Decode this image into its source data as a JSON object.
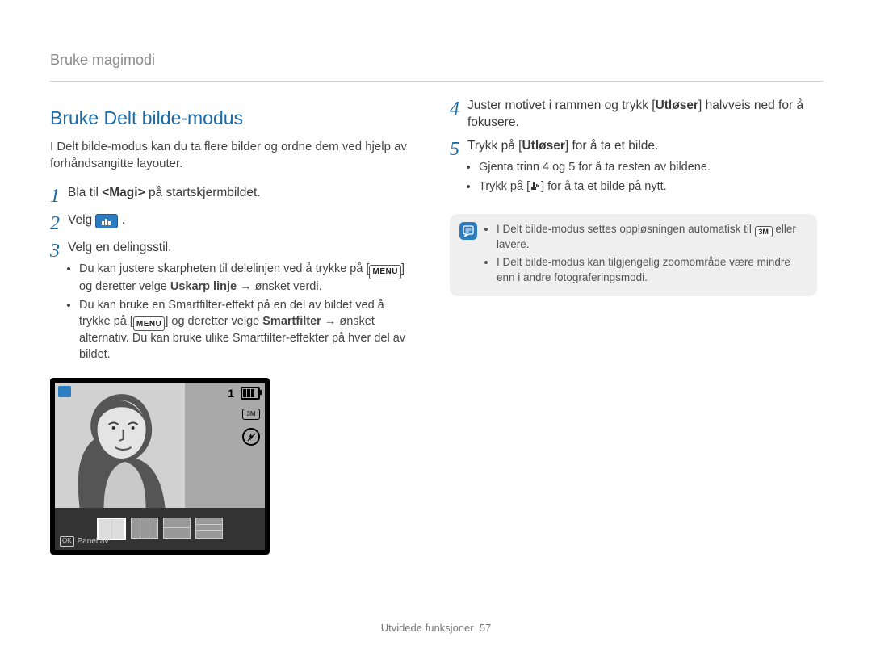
{
  "breadcrumb": "Bruke magimodi",
  "section_title": "Bruke Delt bilde-modus",
  "intro": "I Delt bilde-modus kan du ta flere bilder og ordne dem ved hjelp av forhåndsangitte layouter.",
  "left": {
    "step1_pre": "Bla til ",
    "step1_magi": "<Magi>",
    "step1_post": " på startskjermbildet.",
    "step2_pre": "Velg ",
    "step2_post": ".",
    "step3_title": "Velg en delingsstil.",
    "step3_bullets": {
      "b1_pre": "Du kan justere skarpheten til delelinjen ved å trykke på [",
      "b1_menu": "MENU",
      "b1_mid": "] og deretter velge ",
      "b1_bold": "Uskarp linje",
      "b1_arrow": " → ",
      "b1_post": "ønsket verdi.",
      "b2_pre": "Du kan bruke en Smartfilter-effekt på en del av bildet ved å trykke på [",
      "b2_menu": "MENU",
      "b2_mid": "] og deretter velge ",
      "b2_bold": "Smartfilter",
      "b2_arrow": " → ",
      "b2_post": "ønsket alternativ. Du kan bruke ulike Smartfilter-effekter på hver del av bildet."
    },
    "lcd": {
      "num": "1",
      "res": "3M",
      "ok": "OK",
      "panel": "Panel av"
    }
  },
  "right": {
    "step4_pre": "Juster motivet i rammen og trykk [",
    "step4_bold": "Utløser",
    "step4_post": "] halvveis ned for å fokusere.",
    "step5_pre": "Trykk på [",
    "step5_bold": "Utløser",
    "step5_post": "] for å ta et bilde.",
    "step5_bullets": {
      "b1": "Gjenta trinn 4 og 5 for å ta resten av bildene.",
      "b2_pre": "Trykk på [",
      "b2_post": "] for å ta et bilde på nytt."
    },
    "note": {
      "n1_pre": "I Delt bilde-modus settes oppløsningen automatisk til ",
      "n1_res": "3M",
      "n1_post": " eller lavere.",
      "n2": "I Delt bilde-modus kan tilgjengelig zoomområde være mindre enn i andre fotograferingsmodi."
    }
  },
  "footer_text": "Utvidede funksjoner",
  "footer_page": "57"
}
